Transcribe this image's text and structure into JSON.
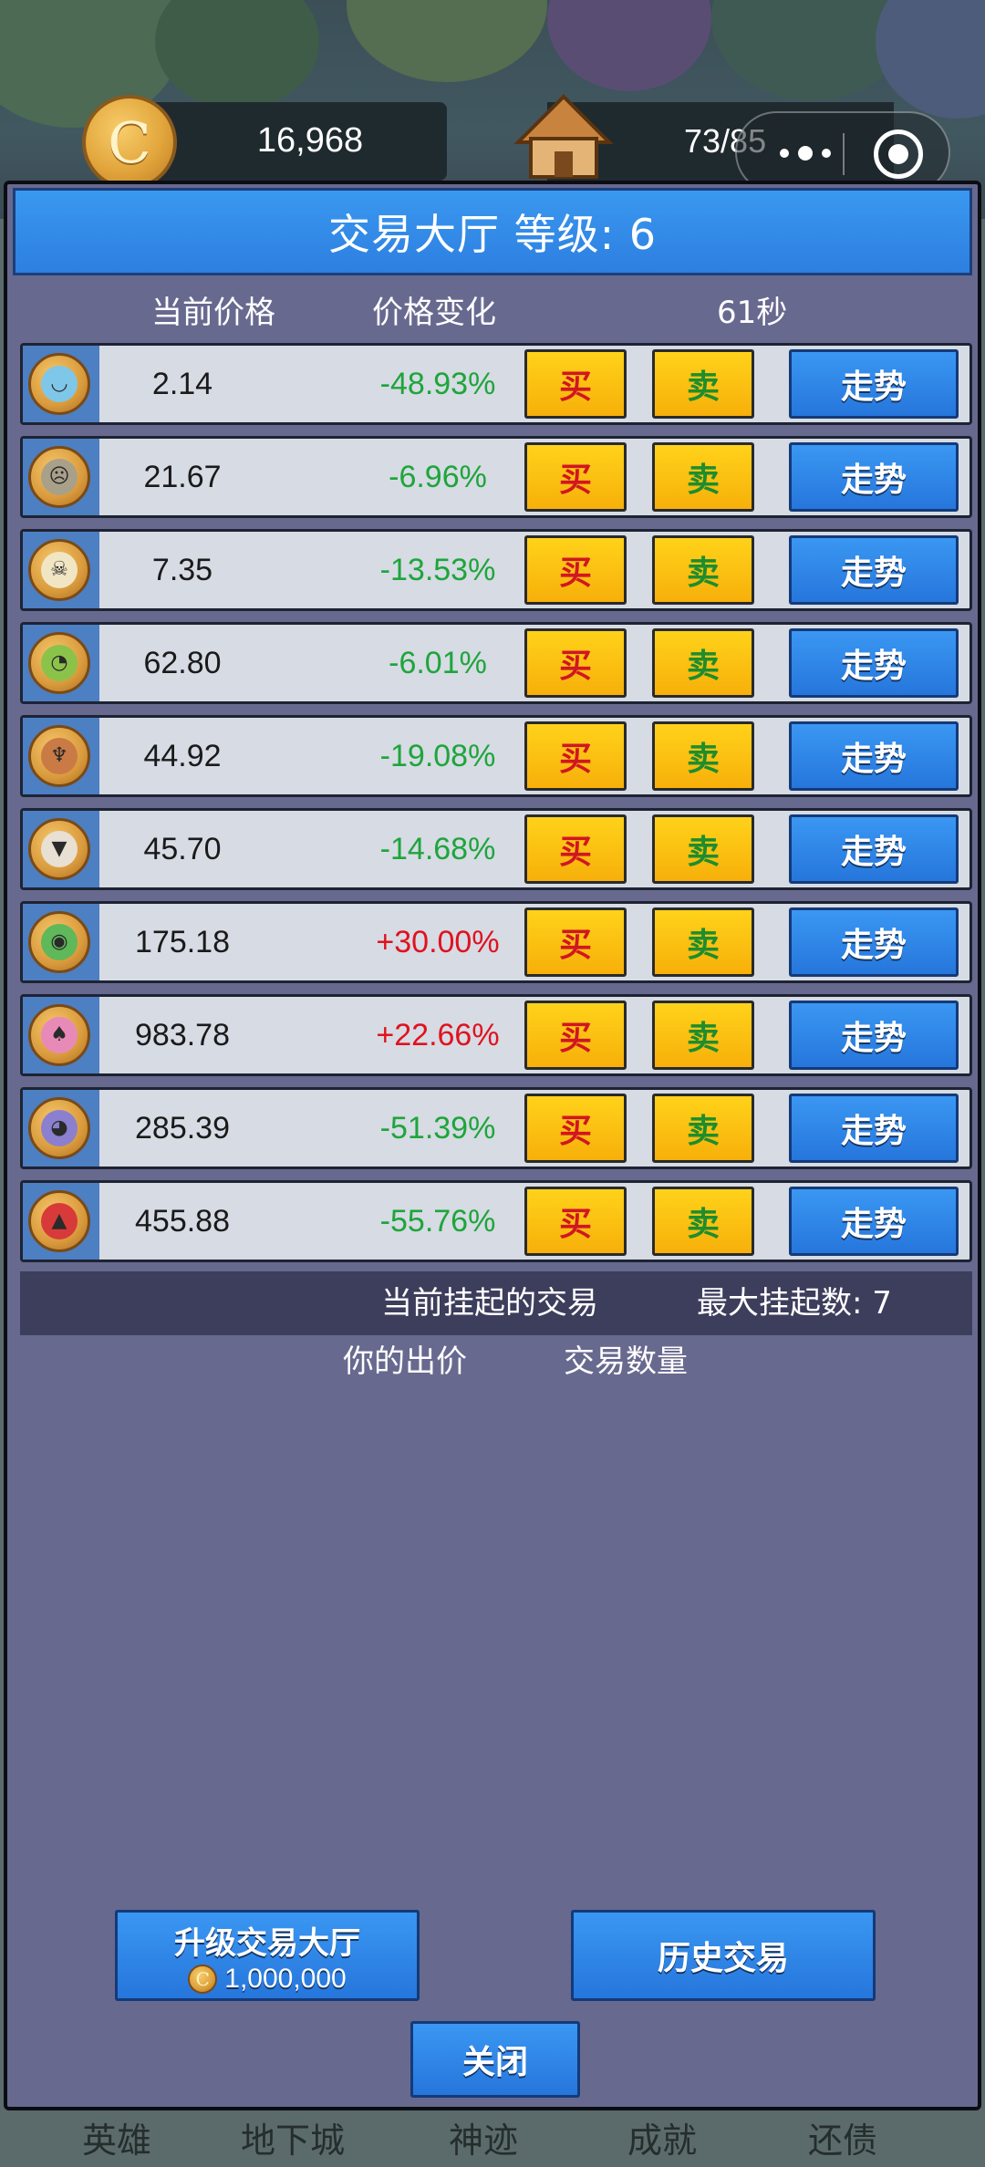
{
  "top_bar": {
    "coin_symbol": "C",
    "coins": "16,968",
    "house_capacity": "73/85"
  },
  "panel": {
    "title": "交易大厅 等级: 6",
    "columns": {
      "price": "当前价格",
      "change": "价格变化",
      "timer": "61秒"
    },
    "buy_label": "买",
    "sell_label": "卖",
    "trend_label": "走势",
    "items": [
      {
        "icon": "blue-slime-icon",
        "price": "2.14",
        "change": "-48.93%",
        "trend": "down"
      },
      {
        "icon": "zombie-icon",
        "price": "21.67",
        "change": "-6.96%",
        "trend": "down"
      },
      {
        "icon": "skull-icon",
        "price": "7.35",
        "change": "-13.53%",
        "trend": "down"
      },
      {
        "icon": "goblin-icon",
        "price": "62.80",
        "change": "-6.01%",
        "trend": "down"
      },
      {
        "icon": "tree-monster-icon",
        "price": "44.92",
        "change": "-19.08%",
        "trend": "down"
      },
      {
        "icon": "wolf-icon",
        "price": "45.70",
        "change": "-14.68%",
        "trend": "down"
      },
      {
        "icon": "orc-icon",
        "price": "175.18",
        "change": "+30.00%",
        "trend": "up"
      },
      {
        "icon": "mushroom-icon",
        "price": "983.78",
        "change": "+22.66%",
        "trend": "up"
      },
      {
        "icon": "purple-imp-icon",
        "price": "285.39",
        "change": "-51.39%",
        "trend": "down"
      },
      {
        "icon": "red-dragon-icon",
        "price": "455.88",
        "change": "-55.76%",
        "trend": "down"
      }
    ],
    "pending": {
      "title": "当前挂起的交易",
      "max_label": "最大挂起数:  7",
      "col_bid": "你的出价",
      "col_qty": "交易数量"
    },
    "upgrade_button": {
      "label": "升级交易大厅",
      "cost": "1,000,000"
    },
    "history_button": "历史交易",
    "close_button": "关闭"
  },
  "bottom_nav": [
    "英雄",
    "地下城",
    "神迹",
    "成就",
    "还债"
  ],
  "colors": {
    "panel_bg": "#68698f",
    "header_blue": "#2d7fe0",
    "buy_text": "#d11623",
    "sell_text": "#1d8d2e",
    "change_down": "#1ea53a",
    "change_up": "#e0121e"
  }
}
